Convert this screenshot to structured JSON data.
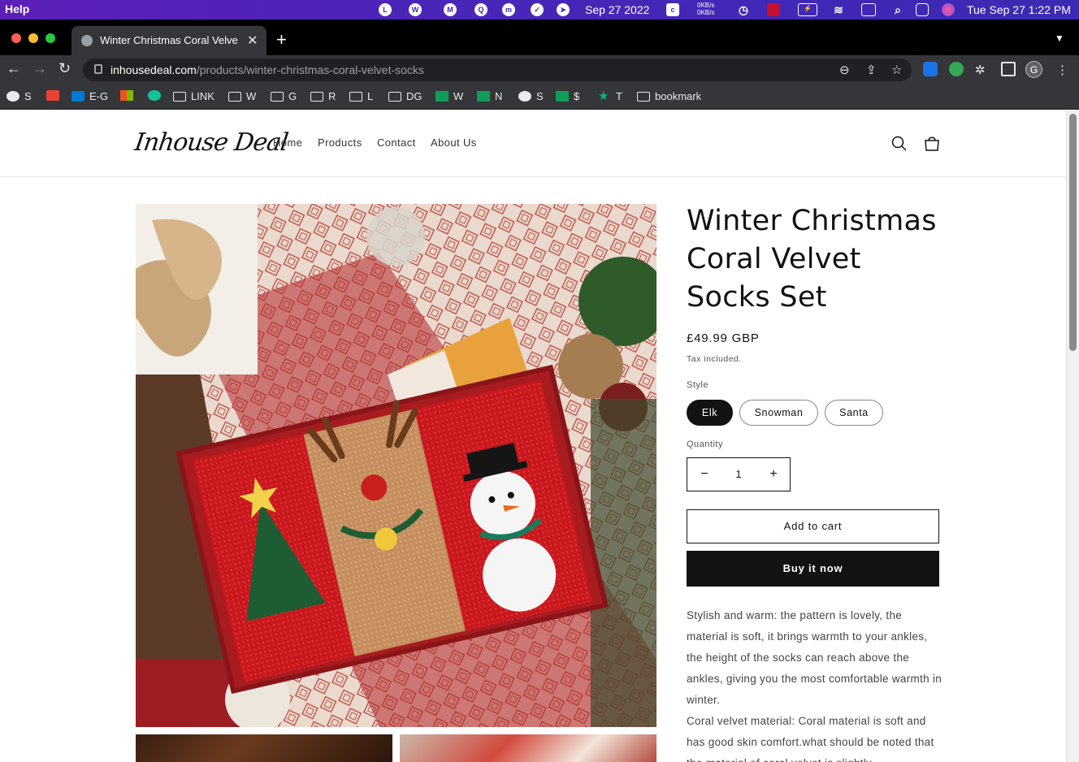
{
  "menubar": {
    "app_menu": "Help",
    "date": "Sep 27 2022",
    "net_up": "0KB/s",
    "net_down": "0KB/s",
    "clock": "Tue Sep 27  1:22 PM"
  },
  "browser": {
    "tab_title": "Winter Christmas Coral Velvet Socks Set",
    "url_host": "inhousedeal.com",
    "url_path": "/products/winter-christmas-coral-velvet-socks",
    "profile_initial": "G",
    "bookmarks": [
      "S",
      "E-G",
      "LINK",
      "W",
      "G",
      "R",
      "L",
      "DG",
      "W",
      "N",
      "S",
      "$",
      "T",
      "bookmark"
    ]
  },
  "site": {
    "logo": "Inhouse Deal",
    "nav": [
      "Home",
      "Products",
      "Contact",
      "About Us"
    ]
  },
  "product": {
    "title": "Winter Christmas Coral Velvet Socks Set",
    "price": "£49.99 GBP",
    "tax_note": "Tax included.",
    "style_label": "Style",
    "styles": [
      "Elk",
      "Snowman",
      "Santa"
    ],
    "selected_style": "Elk",
    "quantity_label": "Quantity",
    "quantity": "1",
    "add_to_cart": "Add to cart",
    "buy_now": "Buy it now",
    "description": [
      "Stylish and warm: the pattern is lovely, the material is soft, it brings warmth to your ankles, the height of the socks can reach above the ankles, giving you the most comfortable warmth in winter.",
      "Coral velvet material: Coral material is soft and has good skin comfort.what should be noted that the material of coral velvet is slightly"
    ]
  },
  "colors": {
    "menubar": "#4a25b8",
    "chrome": "#35363a",
    "text": "#121212",
    "button_dark": "#121212"
  }
}
